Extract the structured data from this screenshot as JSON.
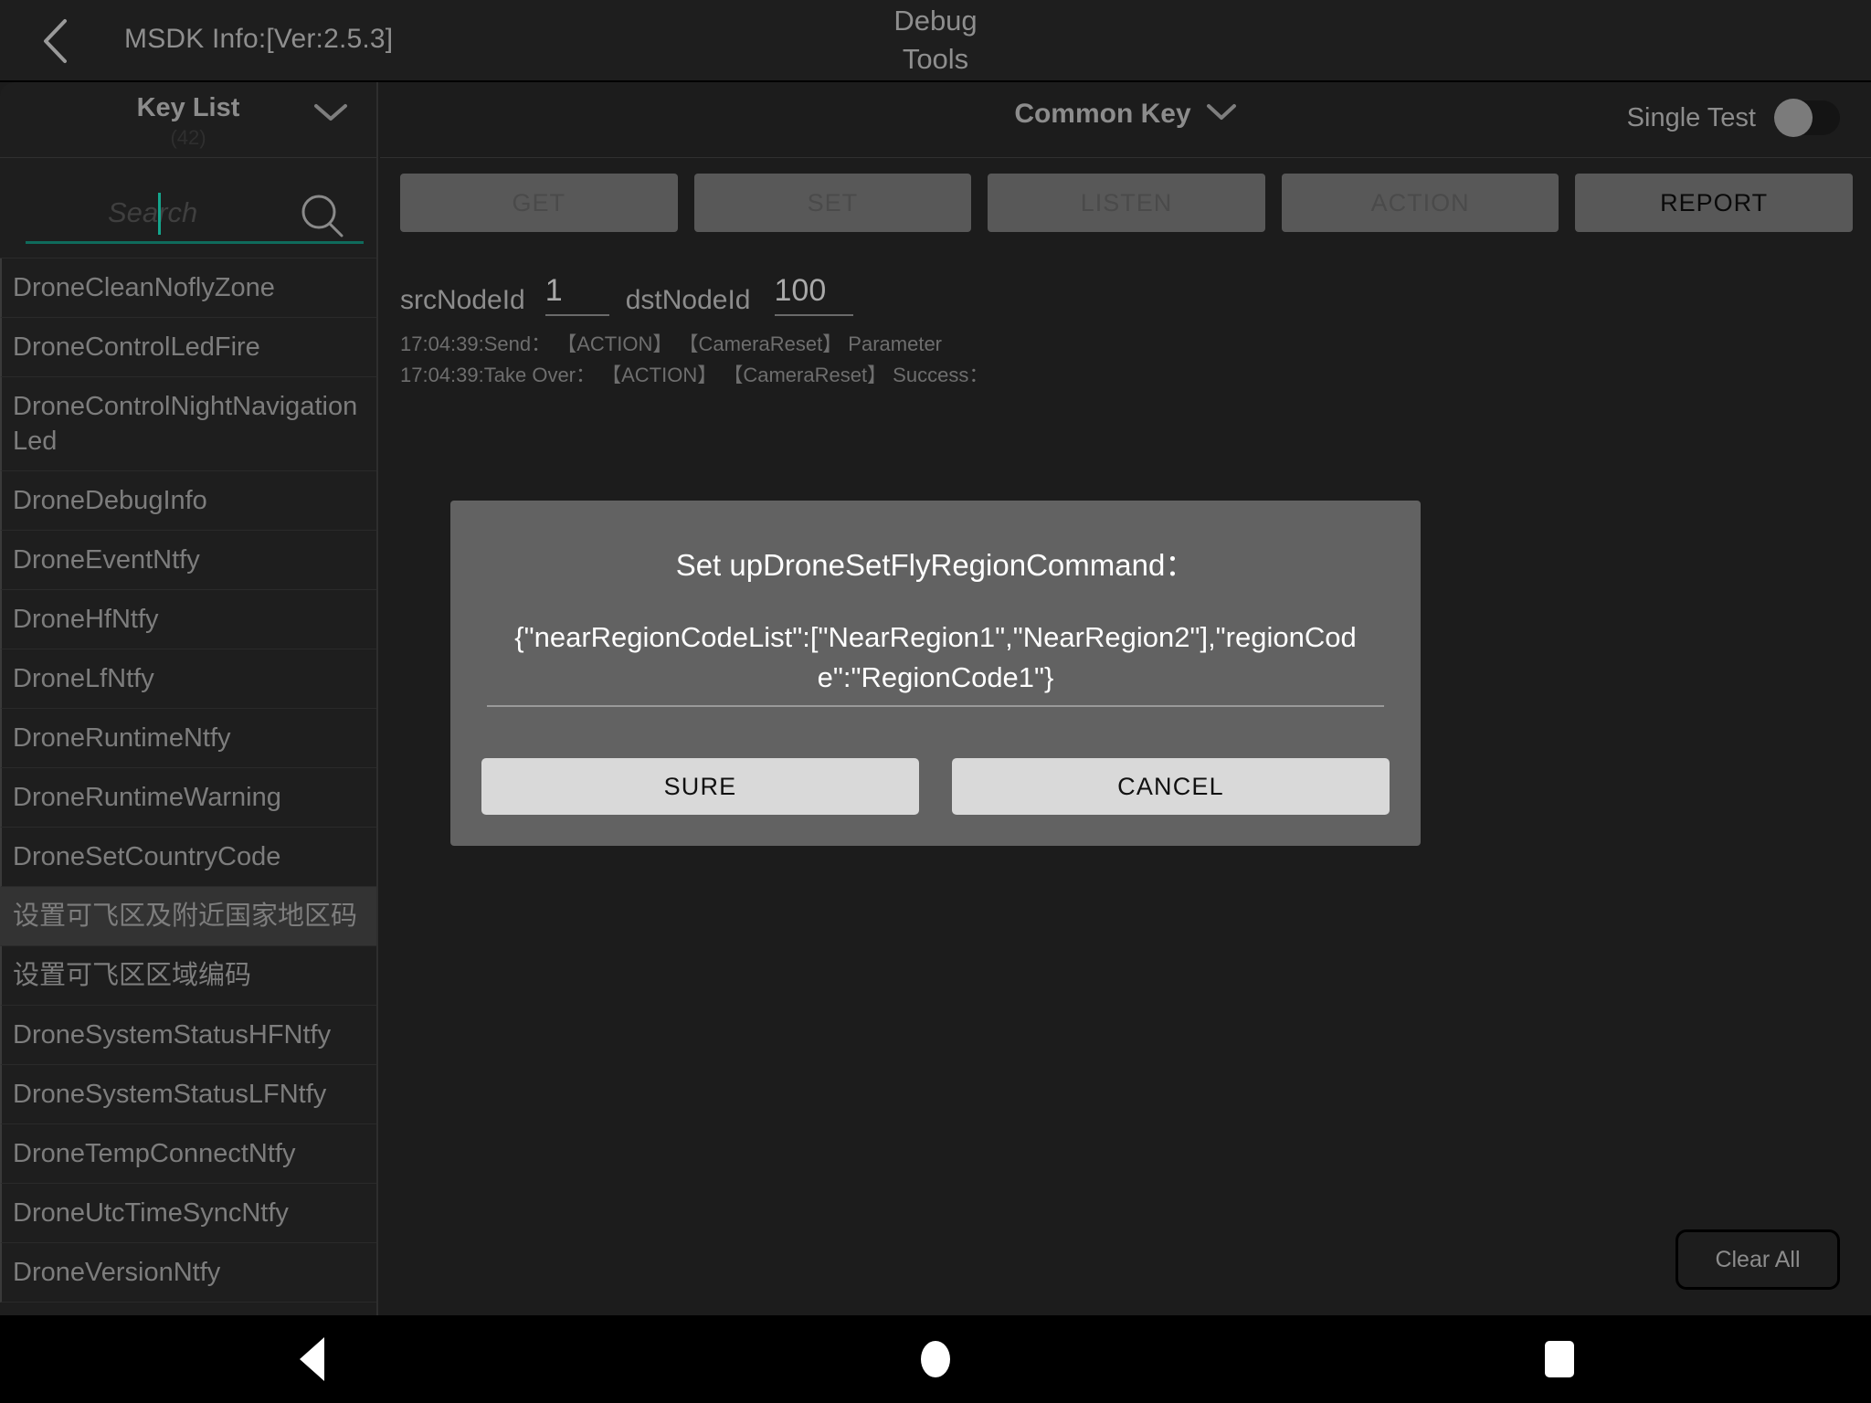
{
  "titlebar": {
    "back_icon": "chevron-left-icon",
    "msdk_info": "MSDK Info:[Ver:2.5.3]",
    "title_line1": "Debug",
    "title_line2": "Tools"
  },
  "sidebar": {
    "header_title": "Key List",
    "header_count": "(42)",
    "chevron_icon": "chevron-down-icon",
    "search": {
      "placeholder": "Search",
      "value": "",
      "icon": "search-icon",
      "underline_color": "#0f6b5c",
      "caret_color": "#14a58c"
    },
    "items": [
      {
        "label": "DroneCleanNoflyZone",
        "selected": false
      },
      {
        "label": "DroneControlLedFire",
        "selected": false
      },
      {
        "label": "DroneControlNightNavigationLed",
        "selected": false
      },
      {
        "label": "DroneDebugInfo",
        "selected": false
      },
      {
        "label": "DroneEventNtfy",
        "selected": false
      },
      {
        "label": "DroneHfNtfy",
        "selected": false
      },
      {
        "label": "DroneLfNtfy",
        "selected": false
      },
      {
        "label": "DroneRuntimeNtfy",
        "selected": false
      },
      {
        "label": "DroneRuntimeWarning",
        "selected": false
      },
      {
        "label": "DroneSetCountryCode",
        "selected": false
      },
      {
        "label": "设置可飞区及附近国家地区码",
        "selected": true
      },
      {
        "label": "设置可飞区区域编码",
        "selected": false
      },
      {
        "label": "DroneSystemStatusHFNtfy",
        "selected": false
      },
      {
        "label": "DroneSystemStatusLFNtfy",
        "selected": false
      },
      {
        "label": "DroneTempConnectNtfy",
        "selected": false
      },
      {
        "label": "DroneUtcTimeSyncNtfy",
        "selected": false
      },
      {
        "label": "DroneVersionNtfy",
        "selected": false
      }
    ]
  },
  "content": {
    "common_key_label": "Common Key",
    "common_key_chevron": "chevron-down-icon",
    "single_test_label": "Single Test",
    "single_test_on": false,
    "actions": [
      {
        "label": "GET",
        "enabled": false
      },
      {
        "label": "SET",
        "enabled": false
      },
      {
        "label": "LISTEN",
        "enabled": false
      },
      {
        "label": "ACTION",
        "enabled": false
      },
      {
        "label": "REPORT",
        "enabled": true
      }
    ],
    "src_node_label": "srcNodeId",
    "src_node_value": "1",
    "dst_node_label": "dstNodeId",
    "dst_node_value": "100",
    "log_lines": [
      "17:04:39:Send：  【ACTION】  【CameraReset】 Parameter",
      "17:04:39:Take Over：  【ACTION】  【CameraReset】 Success："
    ],
    "clear_all_label": "Clear All"
  },
  "dialog": {
    "title": "Set upDroneSetFlyRegionCommand：",
    "value": "{\"nearRegionCodeList\":[\"NearRegion1\",\"NearRegion2\"],\"regionCode\":\"RegionCode1\"}",
    "confirm_label": "SURE",
    "cancel_label": "CANCEL",
    "background_color": "#626262",
    "button_color": "#d9d9d9"
  },
  "navbar": {
    "back_icon": "triangle-back-icon",
    "home_icon": "circle-home-icon",
    "recent_icon": "square-recent-icon"
  }
}
